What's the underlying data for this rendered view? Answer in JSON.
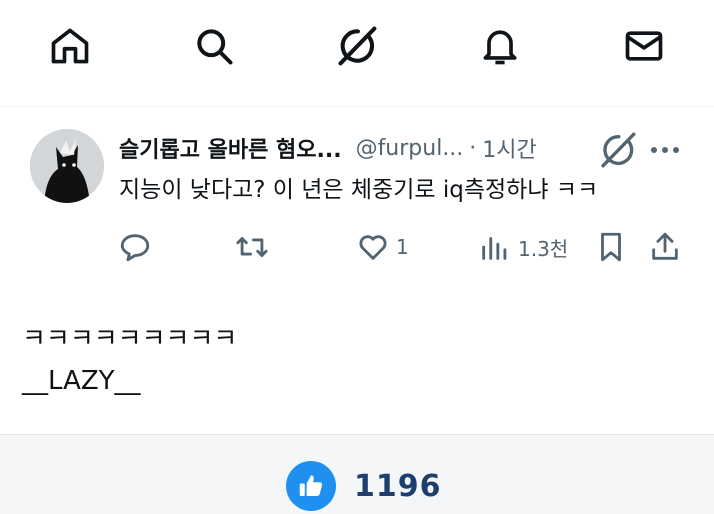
{
  "nav": {
    "items": [
      {
        "name": "home",
        "icon": "home-icon"
      },
      {
        "name": "search",
        "icon": "search-icon"
      },
      {
        "name": "grok",
        "icon": "grok-icon"
      },
      {
        "name": "notifications",
        "icon": "bell-icon"
      },
      {
        "name": "messages",
        "icon": "mail-icon"
      }
    ]
  },
  "tweet": {
    "display_name": "슬기롭고 올바른 혐오...",
    "handle": "@furpul...",
    "separator": "·",
    "time": "1시간",
    "text": "지능이 낮다고? 이 년은 체중기로 iq측정하냐 ㅋㅋ",
    "actions": {
      "reply_icon": "reply-icon",
      "retweet_icon": "retweet-icon",
      "like_icon": "heart-icon",
      "like_count": "1",
      "views_icon": "views-icon",
      "views_count": "1.3천",
      "bookmark_icon": "bookmark-icon",
      "share_icon": "share-icon"
    }
  },
  "post": {
    "line1": "ㅋㅋㅋㅋㅋㅋㅋㅋㅋ",
    "line2": "__LAZY__"
  },
  "footer": {
    "like_count": "1196",
    "icon": "thumbs-up-icon"
  },
  "colors": {
    "text": "#0f1419",
    "muted": "#536471",
    "like_blue": "#1f90f0",
    "count_navy": "#1c3f6e"
  }
}
